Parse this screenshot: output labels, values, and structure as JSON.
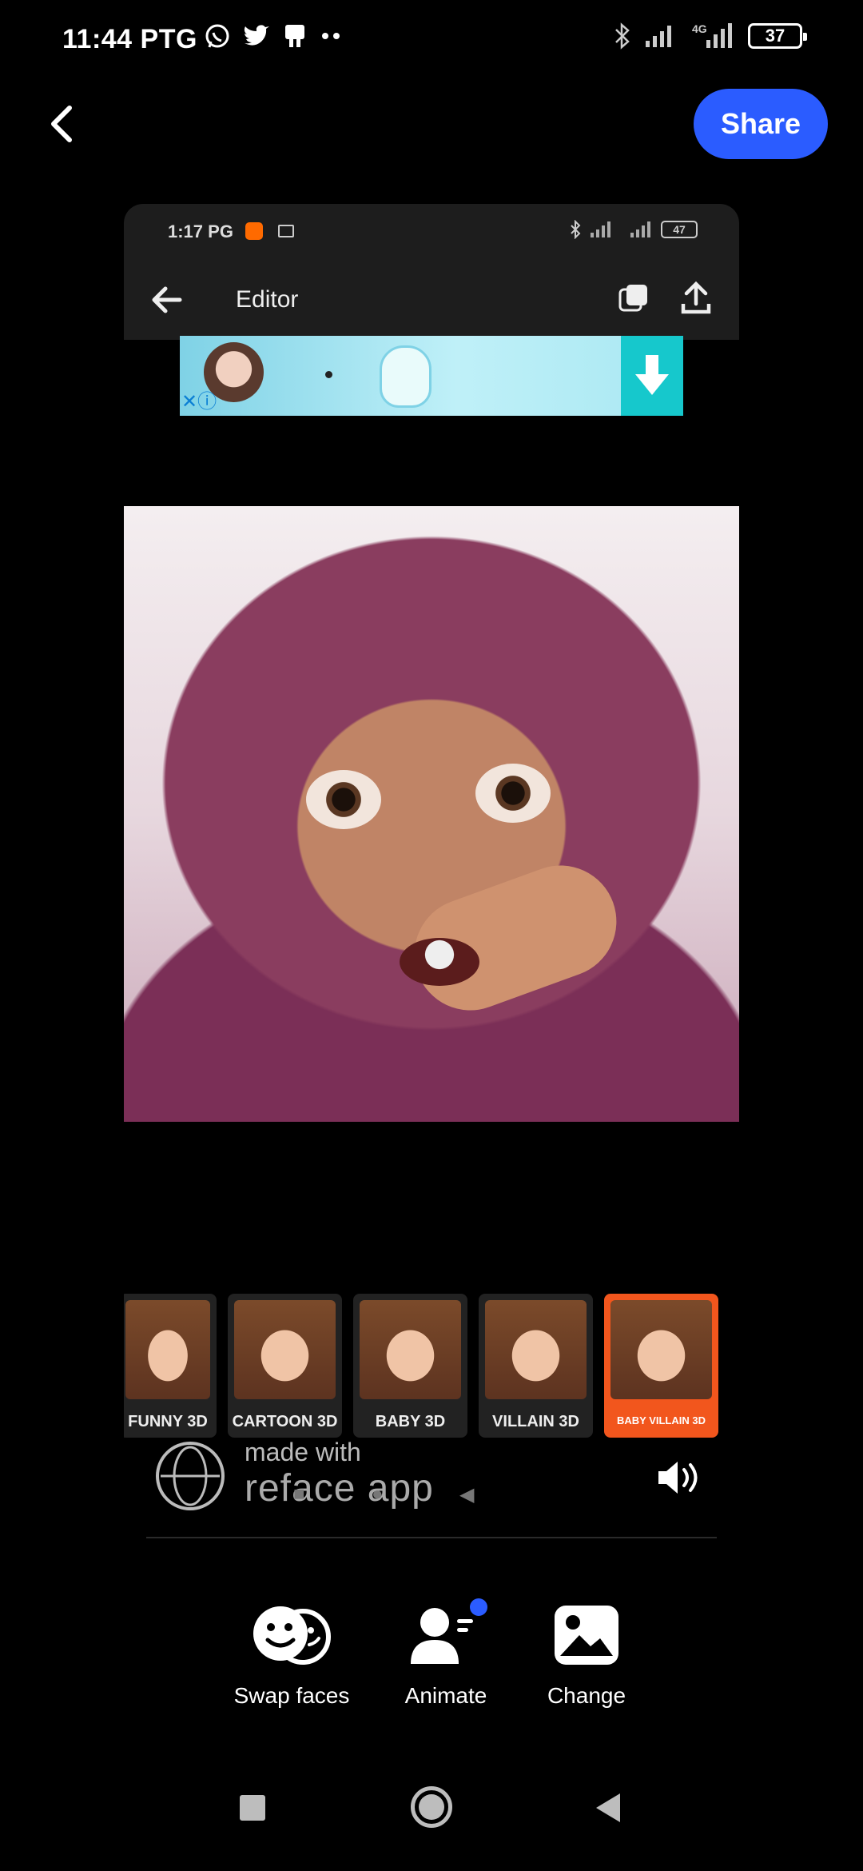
{
  "status_bar": {
    "time": "11:44 PTG",
    "network": "4G",
    "battery": "37"
  },
  "header": {
    "share_label": "Share"
  },
  "video": {
    "inner_status": {
      "time": "1:17 PG",
      "battery": "47"
    },
    "inner_title": "Editor",
    "styles": [
      {
        "label": "FUNNY 3D",
        "selected": false
      },
      {
        "label": "CARTOON 3D",
        "selected": false
      },
      {
        "label": "BABY 3D",
        "selected": false
      },
      {
        "label": "VILLAIN 3D",
        "selected": false
      },
      {
        "label": "BABY VILLAIN 3D",
        "selected": true
      }
    ],
    "watermark": {
      "made_with": "made with",
      "app_name": "reface app"
    }
  },
  "actions": [
    {
      "label": "Swap faces",
      "icon": "swap-faces-icon"
    },
    {
      "label": "Animate",
      "icon": "animate-icon",
      "badge": true
    },
    {
      "label": "Change",
      "icon": "image-icon"
    }
  ],
  "colors": {
    "accent": "#2b5cff",
    "selected_style": "#f2561d"
  }
}
